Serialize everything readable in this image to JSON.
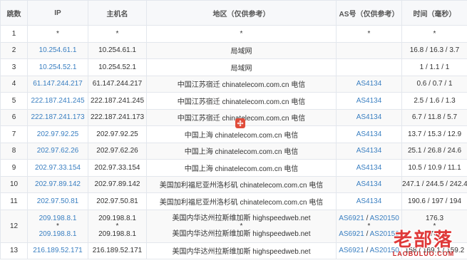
{
  "headers": {
    "hop": "跳数",
    "ip": "IP",
    "host": "主机名",
    "location": "地区（仅供参考）",
    "as": "AS号（仅供参考）",
    "time": "时间（毫秒）"
  },
  "rows": [
    {
      "hop": "1",
      "ip": "*",
      "host": "*",
      "location": "*",
      "as": "*",
      "time": "*"
    },
    {
      "hop": "2",
      "ip": "10.254.61.1",
      "host": "10.254.61.1",
      "location": "局域网",
      "as": "",
      "time": "16.8 / 16.3 / 3.7"
    },
    {
      "hop": "3",
      "ip": "10.254.52.1",
      "host": "10.254.52.1",
      "location": "局域网",
      "as": "",
      "time": "1 / 1.1 / 1"
    },
    {
      "hop": "4",
      "ip": "61.147.244.217",
      "host": "61.147.244.217",
      "location": "中国江苏宿迁 chinatelecom.com.cn 电信",
      "as": "AS4134",
      "time": "0.6 / 0.7 / 1"
    },
    {
      "hop": "5",
      "ip": "222.187.241.245",
      "host": "222.187.241.245",
      "location": "中国江苏宿迁 chinatelecom.com.cn 电信",
      "as": "AS4134",
      "time": "2.5 / 1.6 / 1.3"
    },
    {
      "hop": "6",
      "ip": "222.187.241.173",
      "host": "222.187.241.173",
      "location": "中国江苏宿迁 chinatelecom.com.cn 电信",
      "as": "AS4134",
      "time": "6.7 / 11.8 / 5.7"
    },
    {
      "hop": "7",
      "ip": "202.97.92.25",
      "host": "202.97.92.25",
      "location": "中国上海 chinatelecom.com.cn 电信",
      "as": "AS4134",
      "time": "13.7 / 15.3 / 12.9"
    },
    {
      "hop": "8",
      "ip": "202.97.62.26",
      "host": "202.97.62.26",
      "location": "中国上海 chinatelecom.com.cn 电信",
      "as": "AS4134",
      "time": "25.1 / 26.8 / 24.6"
    },
    {
      "hop": "9",
      "ip": "202.97.33.154",
      "host": "202.97.33.154",
      "location": "中国上海 chinatelecom.com.cn 电信",
      "as": "AS4134",
      "time": "10.5 / 10.9 / 11.1"
    },
    {
      "hop": "10",
      "ip": "202.97.89.142",
      "host": "202.97.89.142",
      "location": "美国加利福尼亚州洛杉矶 chinatelecom.com.cn 电信",
      "as": "AS4134",
      "time": "247.1 / 244.5 / 242.4"
    },
    {
      "hop": "11",
      "ip": "202.97.50.81",
      "host": "202.97.50.81",
      "location": "美国加利福尼亚州洛杉矶 chinatelecom.com.cn 电信",
      "as": "AS4134",
      "time": "190.6 / 197 / 194"
    }
  ],
  "row12": {
    "hop": "12",
    "ip_a": "209.198.8.1",
    "ip_star": "*",
    "ip_b": "209.198.8.1",
    "host_a": "209.198.8.1",
    "host_star": "*",
    "host_b": "209.198.8.1",
    "loc_a": "美国内华达州拉斯维加斯 highspeedweb.net",
    "loc_star": "*",
    "loc_b": "美国内华达州拉斯维加斯 highspeedweb.net",
    "as_a1": "AS6921",
    "as_sep": "/",
    "as_a2": "AS20150",
    "as_star": "*",
    "as_b1": "AS6921",
    "as_b2": "AS20150",
    "time_a": "176.3",
    "time_star": "*",
    "time_b": "176.3"
  },
  "row13": {
    "hop": "13",
    "ip": "216.189.52.171",
    "host": "216.189.52.171",
    "location": "美国内华达州拉斯维加斯 highspeedweb.net",
    "as1": "AS6921",
    "as_sep": "/",
    "as2": "AS20150",
    "time": "158 / 169.1 / 159.2"
  },
  "watermark": {
    "cn": "老部落",
    "en": "LAOBULUO.COM"
  },
  "colors": {
    "link": "#3a7fc1",
    "header_bg": "#f7f8fa",
    "border": "#e3e7ed",
    "watermark": "#dc2828",
    "move_icon": "#e04d3b"
  },
  "icons": {
    "move": "move-arrows-icon"
  }
}
